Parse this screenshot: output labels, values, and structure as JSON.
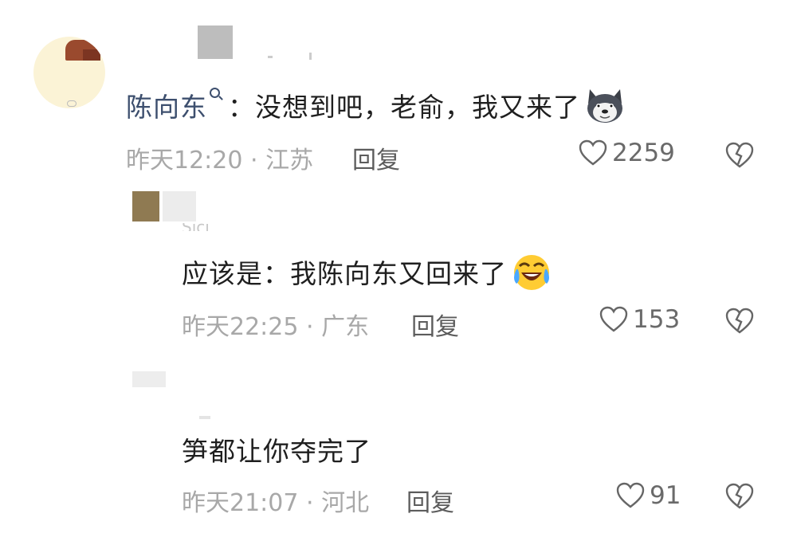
{
  "comments": [
    {
      "user": "陈向东",
      "text": "：没想到吧，老俞，我又来了",
      "time": "昨天12:20",
      "location": "江苏",
      "reply_label": "回复",
      "likes": "2259",
      "emoji_icon": "husky-dog-emoji"
    },
    {
      "user": "Sici",
      "text": "应该是：我陈向东又回来了",
      "time": "昨天22:25",
      "location": "广东",
      "reply_label": "回复",
      "likes": "153",
      "emoji_icon": "laughing-crying-emoji"
    },
    {
      "user": "",
      "text": "笋都让你夺完了",
      "time": "昨天21:07",
      "location": "河北",
      "reply_label": "回复",
      "likes": "91"
    }
  ],
  "separator": " · ",
  "colors": {
    "username": "#3d4f6e",
    "meta": "#a8a8a8",
    "text": "#1f1f1f"
  }
}
